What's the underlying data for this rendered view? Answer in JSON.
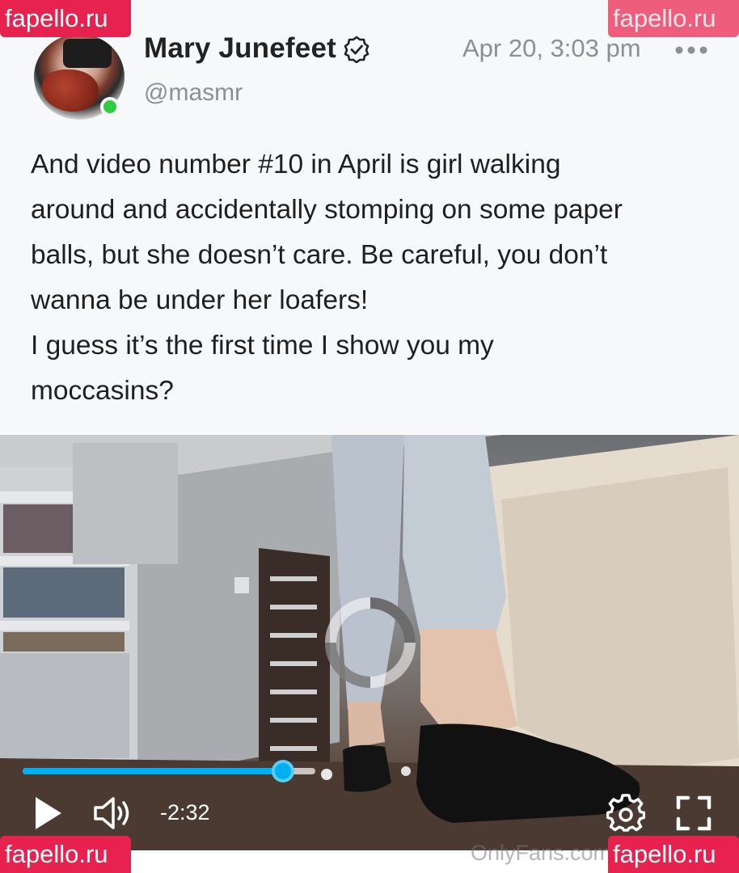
{
  "post": {
    "author_name": "Mary Junefeet",
    "handle": "@masmr",
    "timestamp": "Apr 20, 3:03 pm",
    "text_lines": [
      "And video number #10 in April is girl walking",
      "around and accidentally stomping on some paper",
      "balls, but she doesn’t care. Be careful, you don’t",
      "wanna be under her loafers!",
      "I guess it’s the first time I show you my",
      "moccasins?"
    ],
    "icons": {
      "verified": "verified-check-icon",
      "more": "more-dots-icon",
      "online": "online-status-dot"
    }
  },
  "video": {
    "time_remaining": "-2:32",
    "progress_fraction": 0.89,
    "watermark": "OnlyFans.com",
    "icons": [
      "loading-spinner-icon",
      "play-icon",
      "volume-icon",
      "settings-icon",
      "fullscreen-icon"
    ]
  },
  "site_watermarks": {
    "top_left": "fapello.ru",
    "top_right": "fapello.ru",
    "bottom_left": "fapello.ru",
    "bottom_right": "fapello.ru"
  },
  "colors": {
    "accent": "#00aff0",
    "online": "#2ecc40",
    "watermark_bg": "#e8224f",
    "muted_text": "#8a8f98"
  }
}
